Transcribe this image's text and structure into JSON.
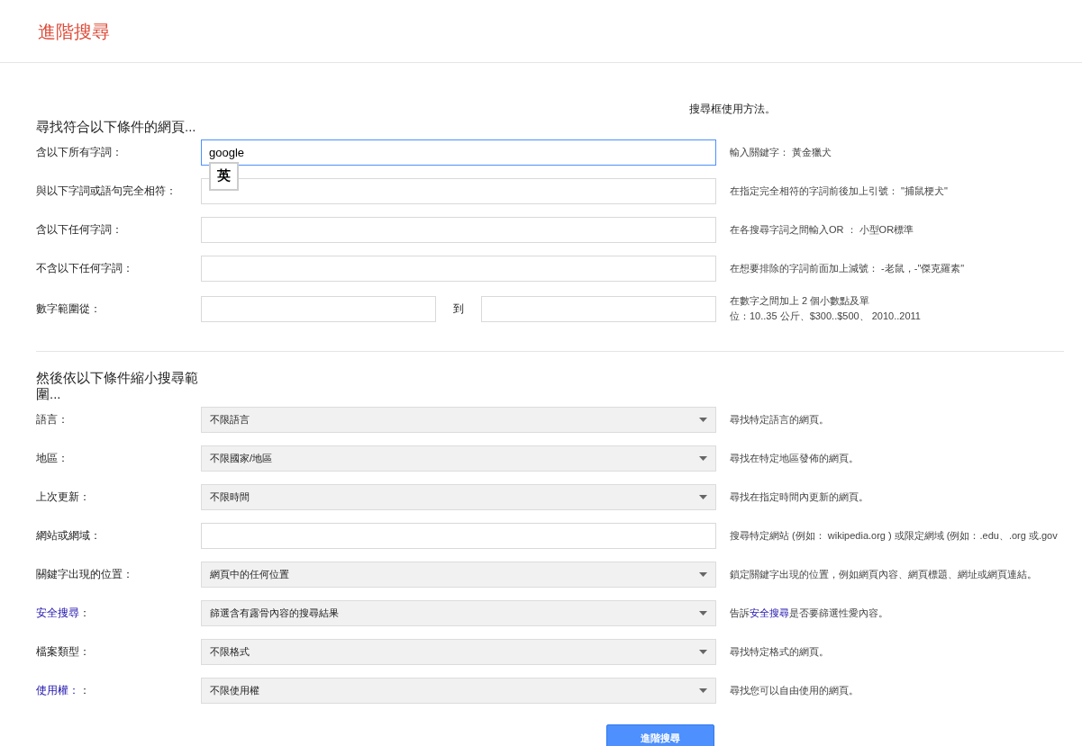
{
  "header": {
    "title": "進階搜尋"
  },
  "section1": {
    "heading": "尋找符合以下條件的網頁...",
    "help_link": "搜尋框使用方法。",
    "rows": [
      {
        "kind": "text",
        "label": "含以下所有字詞：",
        "value": "google",
        "focused": true,
        "ime": "英",
        "hint": "輸入關鍵字： 黃金獵犬"
      },
      {
        "kind": "text",
        "label": "與以下字詞或語句完全相符：",
        "value": "",
        "focused": false,
        "hint": "在指定完全相符的字詞前後加上引號： \"捕鼠梗犬\""
      },
      {
        "kind": "text",
        "label": "含以下任何字詞：",
        "value": "",
        "focused": false,
        "hint": "在各搜尋字詞之間輸入OR ： 小型OR標準"
      },
      {
        "kind": "text",
        "label": "不含以下任何字詞：",
        "value": "",
        "focused": false,
        "hint": "在想要排除的字詞前面加上減號： -老鼠，-\"傑克羅素\""
      },
      {
        "kind": "range",
        "label": "數字範圍從：",
        "to_label": "到",
        "hint": "在數字之間加上 2 個小數點及單",
        "hint_line2": "位：10..35 公斤、$300..$500、 2010..2011"
      }
    ]
  },
  "section2": {
    "heading": "然後依以下條件縮小搜尋範圍...",
    "rows": [
      {
        "kind": "select",
        "label": "語言：",
        "value": "不限語言",
        "hint": "尋找特定語言的網頁。"
      },
      {
        "kind": "select",
        "label": "地區：",
        "value": "不限國家/地區",
        "hint": "尋找在特定地區發佈的網頁。"
      },
      {
        "kind": "select",
        "label": "上次更新：",
        "value": "不限時間",
        "hint": "尋找在指定時間內更新的網頁。"
      },
      {
        "kind": "text",
        "label": "網站或網域：",
        "value": "",
        "focused": false,
        "hint": "搜尋特定網站 (例如： wikipedia.org ) 或限定網域 (例如：.edu、.org 或.gov"
      },
      {
        "kind": "select",
        "label": "關鍵字出現的位置：",
        "value": "網頁中的任何位置",
        "hint": "鎖定關鍵字出現的位置，例如網頁內容、網頁標題、網址或網頁連結。"
      },
      {
        "kind": "select",
        "label_link": "安全搜尋",
        "label": "：",
        "value": "篩選含有露骨內容的搜尋結果",
        "hint": "告訴",
        "hint_link": "安全搜尋",
        "hint_after": "是否要篩選性愛內容。"
      },
      {
        "kind": "select",
        "label": "檔案類型：",
        "value": "不限格式",
        "hint": "尋找特定格式的網頁。"
      },
      {
        "kind": "select",
        "label_link": "使用權：",
        "label": "：",
        "value": "不限使用權",
        "hint": "尋找您可以自由使用的網頁。"
      }
    ]
  },
  "submit": "進階搜尋"
}
